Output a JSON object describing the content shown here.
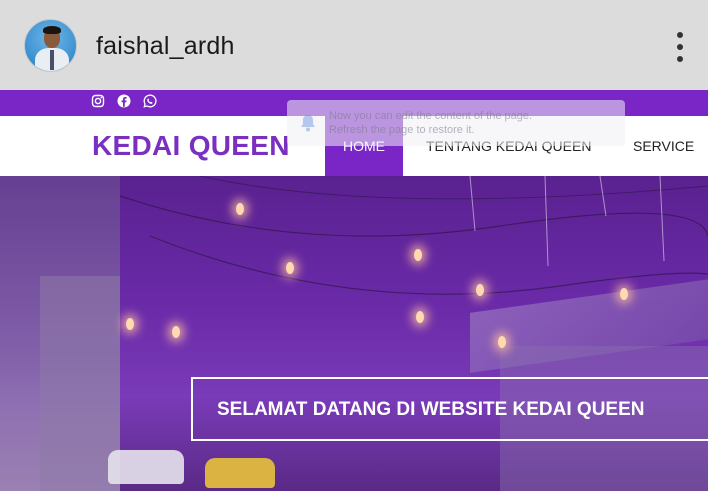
{
  "instagram": {
    "username": "faishal_ardh",
    "avatar_icon": "profile-photo",
    "menu_icon": "more-vertical-icon"
  },
  "site": {
    "topbar": {
      "color": "#7a26c6",
      "social_icons": [
        "instagram-icon",
        "facebook-icon",
        "whatsapp-icon"
      ]
    },
    "brand": "KEDAI QUEEN",
    "nav": {
      "home": "HOME",
      "about": "TENTANG KEDAI QUEEN",
      "service": "SERVICE"
    },
    "toast": {
      "line1": "Now you can edit the content of the page.",
      "line2": "Refresh the page to restore it."
    },
    "hero": {
      "welcome": "SELAMAT DATANG DI WEBSITE KEDAI QUEEN"
    },
    "accent_color": "#7a2fc0"
  }
}
